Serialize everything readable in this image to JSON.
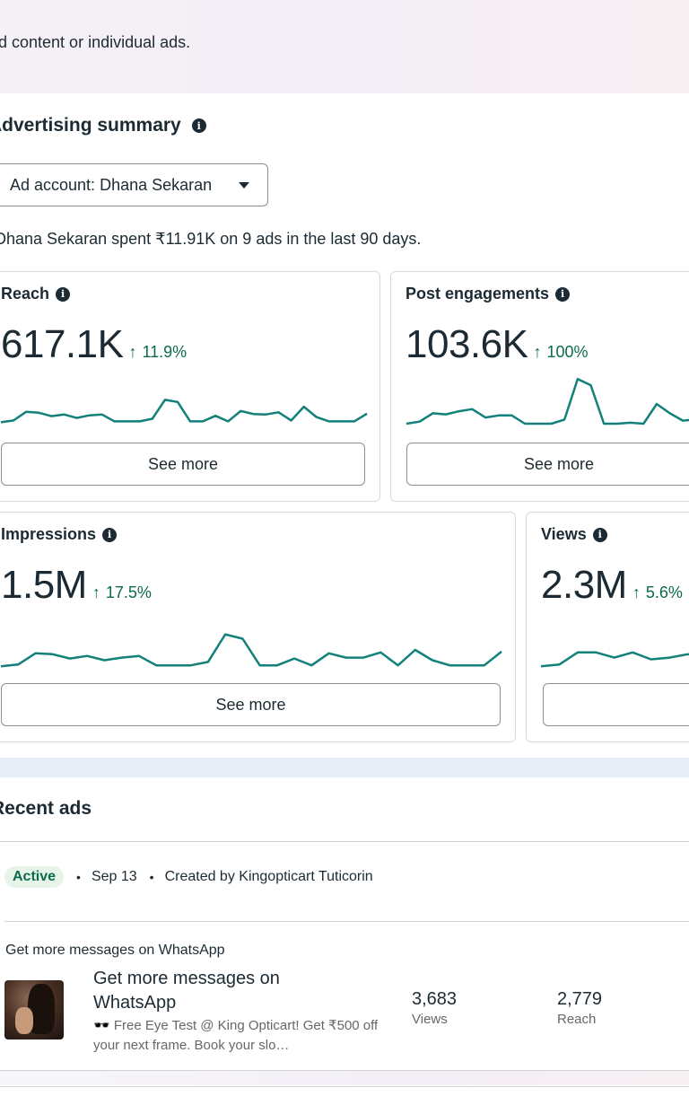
{
  "header": {
    "description_fragment": "d content or individual ads."
  },
  "advertising_summary": {
    "title": "Advertising summary",
    "ad_account_dropdown": "Ad account: Dhana Sekaran",
    "summary_text": "Dhana Sekaran spent ₹11.91K on 9 ads in the last 90 days."
  },
  "metrics": [
    {
      "label": "Reach",
      "value": "617.1K",
      "change": "11.9%",
      "trend": "up",
      "button": "See more",
      "sparkline": [
        0.18,
        0.22,
        0.42,
        0.4,
        0.32,
        0.36,
        0.28,
        0.34,
        0.36,
        0.2,
        0.2,
        0.2,
        0.26,
        0.7,
        0.65,
        0.2,
        0.2,
        0.33,
        0.2,
        0.44,
        0.37,
        0.36,
        0.41,
        0.22,
        0.54,
        0.3,
        0.2,
        0.2,
        0.2,
        0.38
      ],
      "color": "#13807a"
    },
    {
      "label": "Post engagements",
      "value": "103.6K",
      "change": "100%",
      "trend": "up",
      "button": "See more",
      "sparkline": [
        0.12,
        0.16,
        0.32,
        0.3,
        0.36,
        0.4,
        0.24,
        0.28,
        0.28,
        0.12,
        0.12,
        0.12,
        0.2,
        0.98,
        0.86,
        0.12,
        0.12,
        0.14,
        0.12,
        0.5,
        0.32,
        0.18,
        0.2
      ],
      "color": "#13807a"
    },
    {
      "label": "Impressions",
      "value": "1.5M",
      "change": "17.5%",
      "trend": "up",
      "button": "See more",
      "sparkline": [
        0.1,
        0.14,
        0.4,
        0.38,
        0.28,
        0.34,
        0.24,
        0.3,
        0.34,
        0.12,
        0.12,
        0.12,
        0.2,
        0.84,
        0.74,
        0.12,
        0.12,
        0.28,
        0.12,
        0.4,
        0.3,
        0.3,
        0.42,
        0.12,
        0.48,
        0.24,
        0.12,
        0.12,
        0.12,
        0.44
      ],
      "color": "#13807a"
    },
    {
      "label": "Views",
      "value": "2.3M",
      "change": "5.6%",
      "trend": "up",
      "button": "",
      "sparkline": [
        0.1,
        0.14,
        0.42,
        0.42,
        0.3,
        0.42,
        0.26,
        0.3,
        0.38,
        0.3
      ],
      "color": "#13807a"
    }
  ],
  "recent_ads": {
    "title": "Recent ads",
    "status_badge": "Active",
    "date": "Sep 13",
    "created_by": "Created by Kingopticart Tuticorin",
    "objective": "Get more messages on WhatsApp",
    "ad_title": "Get more messages on WhatsApp",
    "ad_description": "🕶️ Free Eye Test @ King Opticart! Get ₹500 off your next frame. Book your slo…",
    "stats": [
      {
        "value": "3,683",
        "label": "Views"
      },
      {
        "value": "2,779",
        "label": "Reach"
      }
    ]
  }
}
